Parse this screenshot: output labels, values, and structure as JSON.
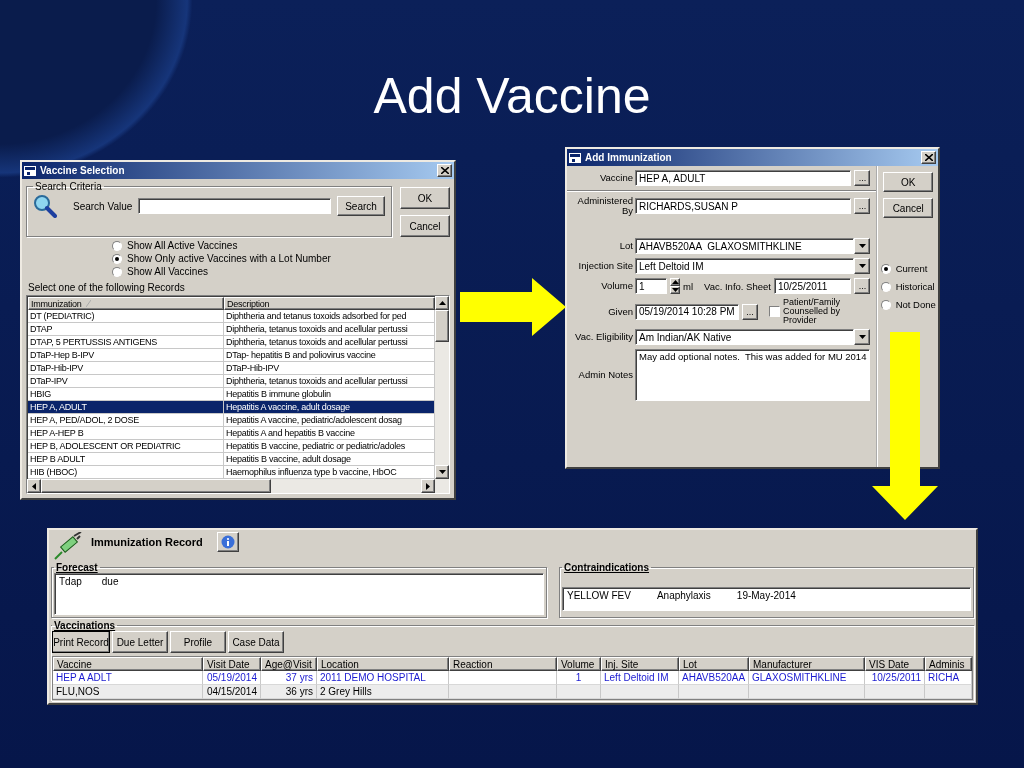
{
  "slide_title": "Add Vaccine",
  "vaccine_selection": {
    "title": "Vaccine Selection",
    "search_group": "Search Criteria",
    "search_label": "Search Value",
    "search_button": "Search",
    "ok_button": "OK",
    "cancel_button": "Cancel",
    "filters": [
      {
        "label": "Show All Active Vaccines",
        "selected": false
      },
      {
        "label": "Show Only active Vaccines with a Lot Number",
        "selected": true
      },
      {
        "label": "Show All Vaccines",
        "selected": false
      }
    ],
    "list_label": "Select one of the following Records",
    "columns": [
      "Immunization",
      "Description"
    ],
    "rows": [
      {
        "immunization": "DT (PEDIATRIC)",
        "description": "Diphtheria and tetanus toxoids adsorbed for ped",
        "selected": false
      },
      {
        "immunization": "DTAP",
        "description": "Diphtheria, tetanus toxoids and acellular pertussi",
        "selected": false
      },
      {
        "immunization": "DTAP, 5 PERTUSSIS ANTIGENS",
        "description": "Diphtheria, tetanus toxoids and acellular pertussi",
        "selected": false
      },
      {
        "immunization": "DTaP-Hep B-IPV",
        "description": "DTap- hepatitis B and poliovirus vaccine",
        "selected": false
      },
      {
        "immunization": "DTaP-Hib-IPV",
        "description": "DTaP-Hib-IPV",
        "selected": false
      },
      {
        "immunization": "DTaP-IPV",
        "description": "Diphtheria, tetanus toxoids and acellular pertussi",
        "selected": false
      },
      {
        "immunization": "HBIG",
        "description": "Hepatitis B immune globulin",
        "selected": false
      },
      {
        "immunization": "HEP A, ADULT",
        "description": "Hepatitis A vaccine, adult dosage",
        "selected": true
      },
      {
        "immunization": "HEP A, PED/ADOL, 2 DOSE",
        "description": "Hepatitis A vaccine, pediatric/adolescent dosag",
        "selected": false
      },
      {
        "immunization": "HEP A-HEP B",
        "description": "Hepatitis A and hepatitis B vaccine",
        "selected": false
      },
      {
        "immunization": "HEP B, ADOLESCENT OR PEDIATRIC",
        "description": "Hepatitis B vaccine, pediatric or pediatric/adoles",
        "selected": false
      },
      {
        "immunization": "HEP B ADULT",
        "description": "Hepatitis B vaccine, adult dosage",
        "selected": false
      },
      {
        "immunization": "HIB (HBOC)",
        "description": "Haemophilus influenza type b vaccine, HbOC",
        "selected": false
      }
    ]
  },
  "add_immunization": {
    "title": "Add Immunization",
    "vaccine": {
      "label": "Vaccine",
      "value": "HEP A, ADULT",
      "browse": "..."
    },
    "administered_by": {
      "label": "Administered By",
      "value": "RICHARDS,SUSAN P",
      "browse": "..."
    },
    "lot": {
      "label": "Lot",
      "value": "AHAVB520AA  GLAXOSMITHKLINE"
    },
    "injection_site": {
      "label": "Injection Site",
      "value": "Left Deltoid IM"
    },
    "volume": {
      "label": "Volume",
      "value": "1",
      "unit": "ml"
    },
    "vis": {
      "label": "Vac. Info. Sheet",
      "value": "10/25/2011",
      "browse": "..."
    },
    "given": {
      "label": "Given",
      "value": "05/19/2014 10:28 PM",
      "browse": "..."
    },
    "counselled": {
      "label": "Patient/Family Counselled by Provider",
      "checked": false
    },
    "eligibility": {
      "label": "Vac. Eligibility",
      "value": "Am Indian/AK Native"
    },
    "notes": {
      "label": "Admin Notes",
      "value": "May add optional notes.  This was added for MU 2014"
    },
    "ok_button": "OK",
    "cancel_button": "Cancel",
    "status": [
      {
        "label": "Current",
        "selected": true
      },
      {
        "label": "Historical",
        "selected": false
      },
      {
        "label": "Not Done",
        "selected": false
      }
    ]
  },
  "immunization_record": {
    "title": "Immunization Record",
    "forecast": {
      "label": "Forecast",
      "items": [
        {
          "vaccine": "Tdap",
          "status": "due"
        }
      ]
    },
    "contraindications": {
      "label": "Contraindications",
      "items": [
        {
          "vaccine": "YELLOW FEV",
          "reaction": "Anaphylaxis",
          "date": "19-May-2014"
        }
      ]
    },
    "vaccinations_label": "Vaccinations",
    "buttons": [
      {
        "label": "Print Record",
        "focused": true
      },
      {
        "label": "Due Letter",
        "focused": false
      },
      {
        "label": "Profile",
        "focused": false
      },
      {
        "label": "Case Data",
        "focused": false
      }
    ],
    "columns": [
      "Vaccine",
      "Visit Date",
      "Age@Visit",
      "Location",
      "Reaction",
      "Volume",
      "Inj. Site",
      "Lot",
      "Manufacturer",
      "VIS Date",
      "Adminis"
    ],
    "rows": [
      {
        "highlighted": true,
        "cells": [
          "HEP A ADLT",
          "05/19/2014",
          "37 yrs",
          "2011 DEMO HOSPITAL",
          null,
          "1",
          "Left Deltoid IM",
          "AHAVB520AA",
          "GLAXOSMITHKLINE",
          "10/25/2011",
          "RICHA"
        ]
      },
      {
        "highlighted": false,
        "cells": [
          "FLU,NOS",
          "04/15/2014",
          "36 yrs",
          "2 Grey Hills",
          null,
          null,
          null,
          null,
          null,
          null,
          null
        ]
      }
    ]
  }
}
